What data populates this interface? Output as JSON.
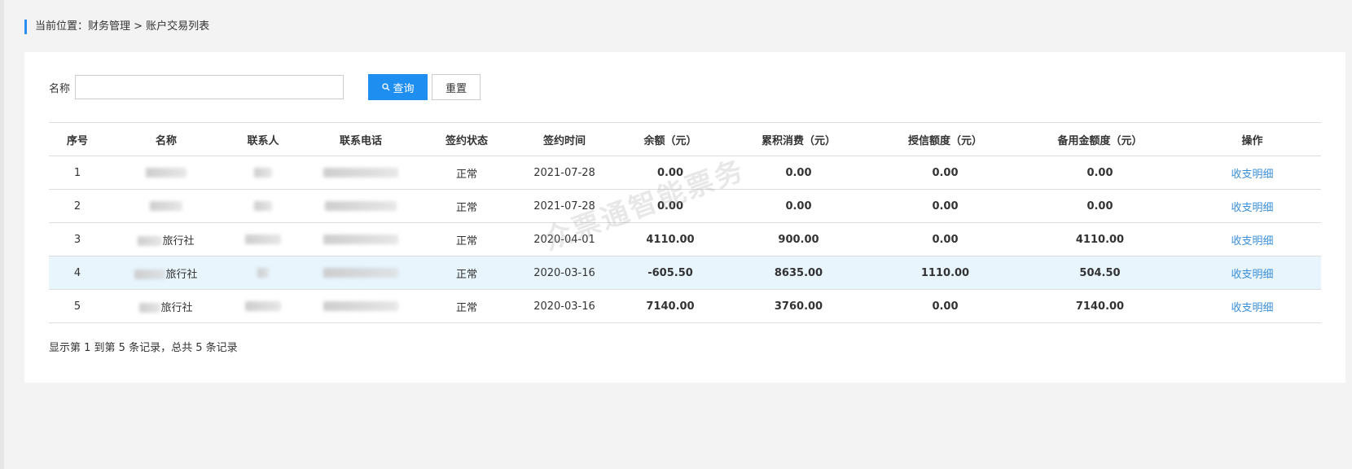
{
  "breadcrumb": {
    "text": "当前位置：财务管理 > 账户交易列表"
  },
  "search": {
    "label": "名称",
    "value": "",
    "placeholder": "",
    "query_label": "查询",
    "reset_label": "重置"
  },
  "table": {
    "headers": [
      "序号",
      "名称",
      "联系人",
      "联系电话",
      "签约状态",
      "签约时间",
      "余额（元）",
      "累积消费（元）",
      "授信额度（元）",
      "备用金额度（元）",
      "操作"
    ],
    "rows": [
      {
        "index": "1",
        "name_visible": "",
        "status": "正常",
        "date": "2021-07-28",
        "balance": "0.00",
        "consumption": "0.00",
        "credit": "0.00",
        "reserve": "0.00",
        "action": "收支明细"
      },
      {
        "index": "2",
        "name_visible": "",
        "status": "正常",
        "date": "2021-07-28",
        "balance": "0.00",
        "consumption": "0.00",
        "credit": "0.00",
        "reserve": "0.00",
        "action": "收支明细"
      },
      {
        "index": "3",
        "name_visible": "旅行社",
        "status": "正常",
        "date": "2020-04-01",
        "balance": "4110.00",
        "consumption": "900.00",
        "credit": "0.00",
        "reserve": "4110.00",
        "action": "收支明细"
      },
      {
        "index": "4",
        "name_visible": "旅行社",
        "status": "正常",
        "date": "2020-03-16",
        "balance": "-605.50",
        "consumption": "8635.00",
        "credit": "1110.00",
        "reserve": "504.50",
        "action": "收支明细"
      },
      {
        "index": "5",
        "name_visible": "旅行社",
        "status": "正常",
        "date": "2020-03-16",
        "balance": "7140.00",
        "consumption": "3760.00",
        "credit": "0.00",
        "reserve": "7140.00",
        "action": "收支明细"
      }
    ]
  },
  "footer": {
    "text": "显示第 1 到第 5 条记录，总共 5 条记录"
  },
  "watermark": {
    "text": "众票通智能票务"
  },
  "colors": {
    "accent": "#1e8ff0",
    "link": "#3b8fd8",
    "highlight_row": "#e8f5fd"
  },
  "icons": {
    "query": "search-icon"
  }
}
